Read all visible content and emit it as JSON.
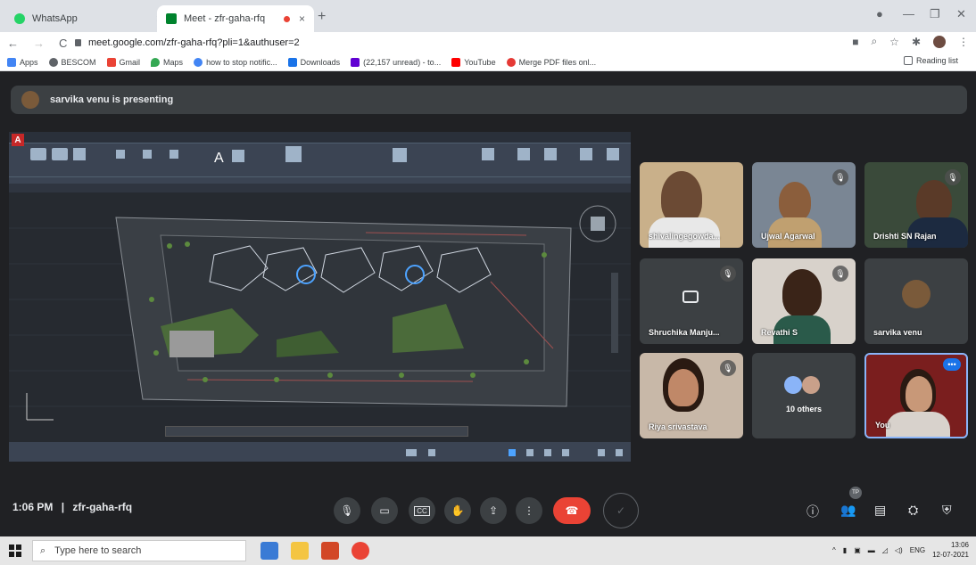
{
  "browser": {
    "tabs": [
      {
        "title": "WhatsApp",
        "favicon_color": "#25d366"
      },
      {
        "title": "Meet - zfr-gaha-rfq",
        "favicon_color": "#00832d"
      }
    ],
    "close_glyph": "×",
    "new_tab_glyph": "+",
    "url": "meet.google.com/zfr-gaha-rfq?pli=1&authuser=2",
    "bookmarks": [
      {
        "label": "Apps",
        "color": "#4285f4"
      },
      {
        "label": "BESCOM",
        "color": "#5f6368"
      },
      {
        "label": "Gmail",
        "color": "#ea4335"
      },
      {
        "label": "Maps",
        "color": "#34a853"
      },
      {
        "label": "how to stop notific...",
        "color": "#4285f4"
      },
      {
        "label": "Downloads",
        "color": "#1a73e8"
      },
      {
        "label": "(22,157 unread) - to...",
        "color": "#6001d2"
      },
      {
        "label": "YouTube",
        "color": "#ff0000"
      },
      {
        "label": "Merge PDF files onl...",
        "color": "#e53935"
      }
    ],
    "reading_list": "Reading list"
  },
  "meet": {
    "presenting_banner": "sarvika venu is presenting",
    "participants": [
      {
        "name": "shivalingegowda...",
        "muted": false
      },
      {
        "name": "Ujwal Agarwal",
        "muted": true
      },
      {
        "name": "Drishti SN Rajan",
        "muted": true
      },
      {
        "name": "Shruchika Manju...",
        "muted": true
      },
      {
        "name": "Revathi S",
        "muted": true
      },
      {
        "name": "sarvika venu",
        "muted": false
      },
      {
        "name": "Riya srivastava",
        "muted": true
      },
      {
        "name": "10 others",
        "muted": false
      },
      {
        "name": "You",
        "muted": false
      }
    ],
    "time": "1:06 PM",
    "separator": "|",
    "meeting_code": "zfr-gaha-rfq",
    "participants_badge": "TP",
    "colors": {
      "end_call": "#ea4335",
      "self_border": "#8ab4f8"
    }
  },
  "taskbar": {
    "search_placeholder": "Type here to search",
    "tray_lang": "ENG",
    "clock_time": "13:06",
    "clock_date": "12-07-2021"
  }
}
